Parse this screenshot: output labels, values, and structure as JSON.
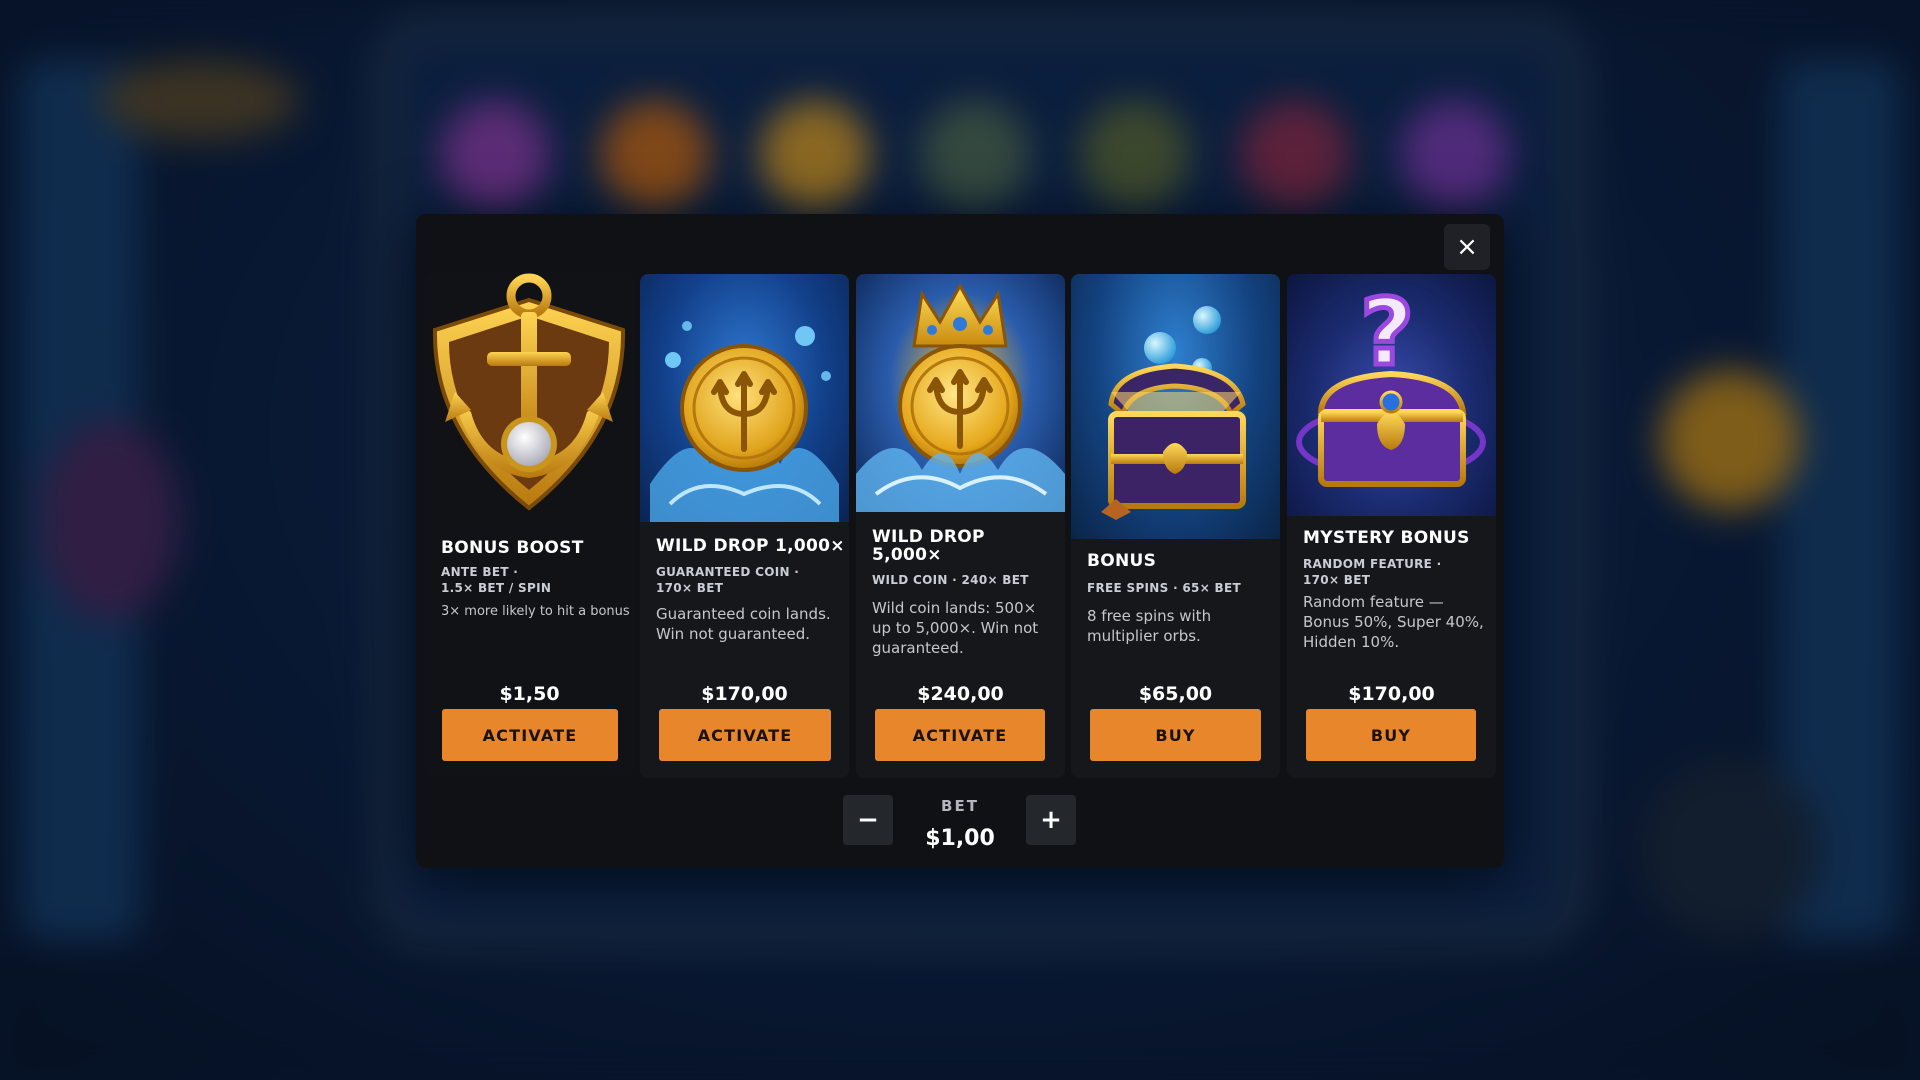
{
  "close_label": "×",
  "cards": [
    {
      "title": "BONUS BOOST",
      "subtitle": "ANTE BET ·\n1.5× BET / SPIN",
      "description": "3× more likely to hit a bonus",
      "price": "$1,50",
      "button": "ACTIVATE",
      "icon": "anchor-shield-icon"
    },
    {
      "title": "WILD DROP 1,000×",
      "subtitle": "GUARANTEED COIN ·\n170× BET",
      "description": "Guaranteed coin lands. Win not guaranteed.",
      "price": "$170,00",
      "button": "ACTIVATE",
      "icon": "trident-coin-icon"
    },
    {
      "title": "WILD DROP\n5,000×",
      "subtitle": "WILD COIN · 240× BET",
      "description": "Wild coin lands: 500× up to 5,000×. Win not guaranteed.",
      "price": "$240,00",
      "button": "ACTIVATE",
      "icon": "crowned-trident-coin-icon"
    },
    {
      "title": "BONUS",
      "subtitle": "FREE SPINS · 65× BET",
      "description": "8 free spins with multiplier orbs.",
      "price": "$65,00",
      "button": "BUY",
      "icon": "treasure-chest-icon"
    },
    {
      "title": "MYSTERY BONUS",
      "subtitle": "RANDOM FEATURE ·\n170× BET",
      "description": "Random feature — Bonus 50%, Super 40%, Hidden 10%.",
      "price": "$170,00",
      "button": "BUY",
      "icon": "mystery-chest-icon"
    }
  ],
  "bet": {
    "label": "BET",
    "value": "$1,00",
    "minus": "−",
    "plus": "+"
  },
  "colors": {
    "accent_button": "#e8862c",
    "modal_bg": "#101114",
    "gold": "#f2b821",
    "purple": "#6b2fa8"
  }
}
